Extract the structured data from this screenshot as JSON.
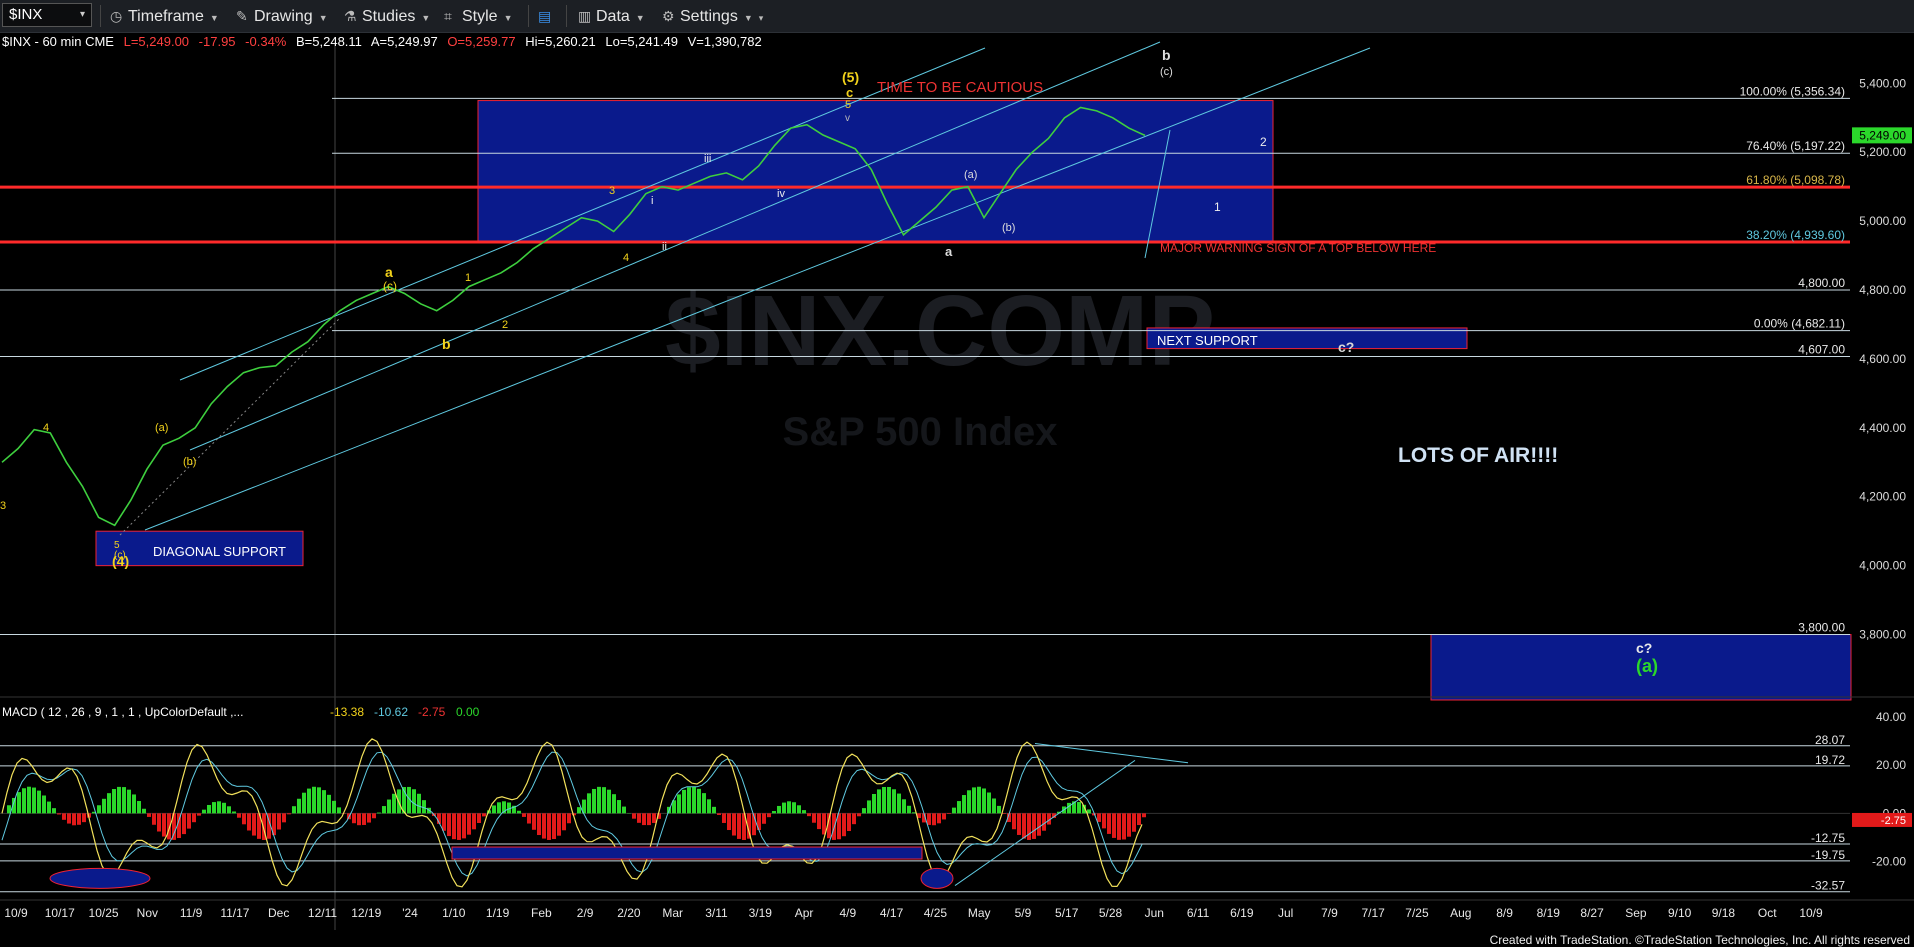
{
  "toolbar": {
    "symbol": "$INX",
    "items": [
      {
        "label": "Timeframe",
        "icon": "gauge-icon"
      },
      {
        "label": "Drawing",
        "icon": "pencil-icon"
      },
      {
        "label": "Studies",
        "icon": "flask-icon"
      },
      {
        "label": "Style",
        "icon": "crop-icon"
      },
      {
        "label": "",
        "icon": "layout-icon"
      },
      {
        "label": "Data",
        "icon": "bar-chart-icon"
      },
      {
        "label": "Settings",
        "icon": "gear-icon"
      }
    ]
  },
  "header": {
    "symbol_info": "$INX - 60 min  CME",
    "last": "L=5,249.00",
    "change": "-17.95",
    "change_pct": "-0.34%",
    "bid": "B=5,248.11",
    "ask": "A=5,249.97",
    "open": "O=5,259.77",
    "high": "Hi=5,260.21",
    "low": "Lo=5,241.49",
    "volume": "V=1,390,782"
  },
  "colors": {
    "background": "#000000",
    "price_line": "#3ecf3e",
    "channel": "#5fc9e0",
    "red_line": "#ff2a2a",
    "box_fill": "#0a1a8c",
    "wave_yellow": "#f2d21b",
    "wave_white": "#d8d8d8",
    "macd_line": "#f2e15b",
    "signal_line": "#5fc9e0",
    "hist_pos": "#2bd82b",
    "hist_neg": "#e21a1a"
  },
  "annotations": {
    "caution": "TIME TO BE CAUTIOUS",
    "warning": "MAJOR WARNING SIGN OF A TOP BELOW HERE",
    "next_support": "NEXT SUPPORT",
    "diagonal_support": "DIAGONAL SUPPORT",
    "lots_of_air": "LOTS OF AIR!!!!",
    "c_q1": "c?",
    "c_q2": "c?",
    "paren_a": "(a)"
  },
  "watermark": {
    "line1": "$INX.COMP",
    "line2": "S&P 500 Index"
  },
  "macd": {
    "label": "MACD ( 12 , 26 , 9 , 1 , 1 , UpColorDefault ,...",
    "value1": "-13.38",
    "value2": "-10.62",
    "value3": "-2.75",
    "value4": "0.00"
  },
  "chart_data": {
    "type": "line",
    "title": "$INX - 60 min",
    "price_axis": {
      "ylim": [
        3610,
        5520
      ],
      "ticks": [
        "5,400.00",
        "5,200.00",
        "5,000.00",
        "4,800.00",
        "4,600.00",
        "4,400.00",
        "4,200.00",
        "4,000.00",
        "3,800.00"
      ]
    },
    "current_price_label": "5,249.00",
    "x_ticks": [
      "10/9",
      "10/17",
      "10/25",
      "Nov",
      "11/9",
      "11/17",
      "Dec",
      "12/11",
      "12/19",
      "'24",
      "1/10",
      "1/19",
      "Feb",
      "2/9",
      "2/20",
      "Mar",
      "3/11",
      "3/19",
      "Apr",
      "4/9",
      "4/17",
      "4/25",
      "May",
      "5/9",
      "5/17",
      "5/28",
      "Jun",
      "6/11",
      "6/19",
      "Jul",
      "7/9",
      "7/17",
      "7/25",
      "Aug",
      "8/9",
      "8/19",
      "8/27",
      "Sep",
      "9/10",
      "9/18",
      "Oct",
      "10/9"
    ],
    "series": [
      {
        "values": [
          4300,
          4340,
          4395,
          4385,
          4300,
          4230,
          4140,
          4117,
          4190,
          4280,
          4350,
          4370,
          4400,
          4470,
          4520,
          4560,
          4575,
          4580,
          4620,
          4650,
          4700,
          4740,
          4770,
          4790,
          4810,
          4790,
          4760,
          4740,
          4770,
          4810,
          4830,
          4850,
          4880,
          4920,
          4950,
          4980,
          5010,
          5000,
          4970,
          5020,
          5080,
          5100,
          5090,
          5110,
          5130,
          5140,
          5120,
          5160,
          5220,
          5270,
          5280,
          5250,
          5230,
          5210,
          5150,
          5050,
          4960,
          5000,
          5040,
          5090,
          5100,
          5010,
          5080,
          5150,
          5200,
          5240,
          5300,
          5330,
          5320,
          5300,
          5270,
          5249
        ]
      }
    ],
    "horizontal_levels": [
      {
        "label": "100.00% (5,356.34)",
        "value": 5356.34
      },
      {
        "label": "76.40% (5,197.22)",
        "value": 5197.22
      },
      {
        "label": "61.80% (5,098.78)",
        "value": 5098.78
      },
      {
        "label": "38.20% (4,939.60)",
        "value": 4939.6
      },
      {
        "label": "4,800.00",
        "value": 4800
      },
      {
        "label": "0.00% (4,682.11)",
        "value": 4682.11
      },
      {
        "label": "4,607.00",
        "value": 4607
      },
      {
        "label": "3,800.00",
        "value": 3800
      }
    ],
    "zones": [
      {
        "name": "upper-target-box",
        "from": 4940,
        "to": 5350
      },
      {
        "name": "next-support",
        "from": 4630,
        "to": 4690
      },
      {
        "name": "diagonal-support",
        "from": 4000,
        "to": 4100
      },
      {
        "name": "lower-target-box",
        "from": 3610,
        "to": 3800
      }
    ],
    "wave_labels": [
      "(5)",
      "c",
      "5",
      "v",
      "a",
      "(c)",
      "b",
      "1",
      "2",
      "3",
      "4",
      "i",
      "ii",
      "iii",
      "iv",
      "a",
      "(a)",
      "(b)",
      "3",
      "4",
      "(b)",
      "(a)",
      "5",
      "(c)",
      "(4)",
      "b",
      "(c)",
      "1",
      "2"
    ],
    "macd_axis": {
      "ylim": [
        -36,
        45
      ],
      "ticks": [
        "40.00",
        "20.00",
        "0.00",
        "-20.00"
      ],
      "levels": [
        "28.07",
        "19.72",
        "-12.75",
        "-19.75",
        "-32.57"
      ],
      "current_label": "-2.75"
    }
  },
  "footer": "Created with TradeStation. ©TradeStation Technologies, Inc. All rights reserved"
}
